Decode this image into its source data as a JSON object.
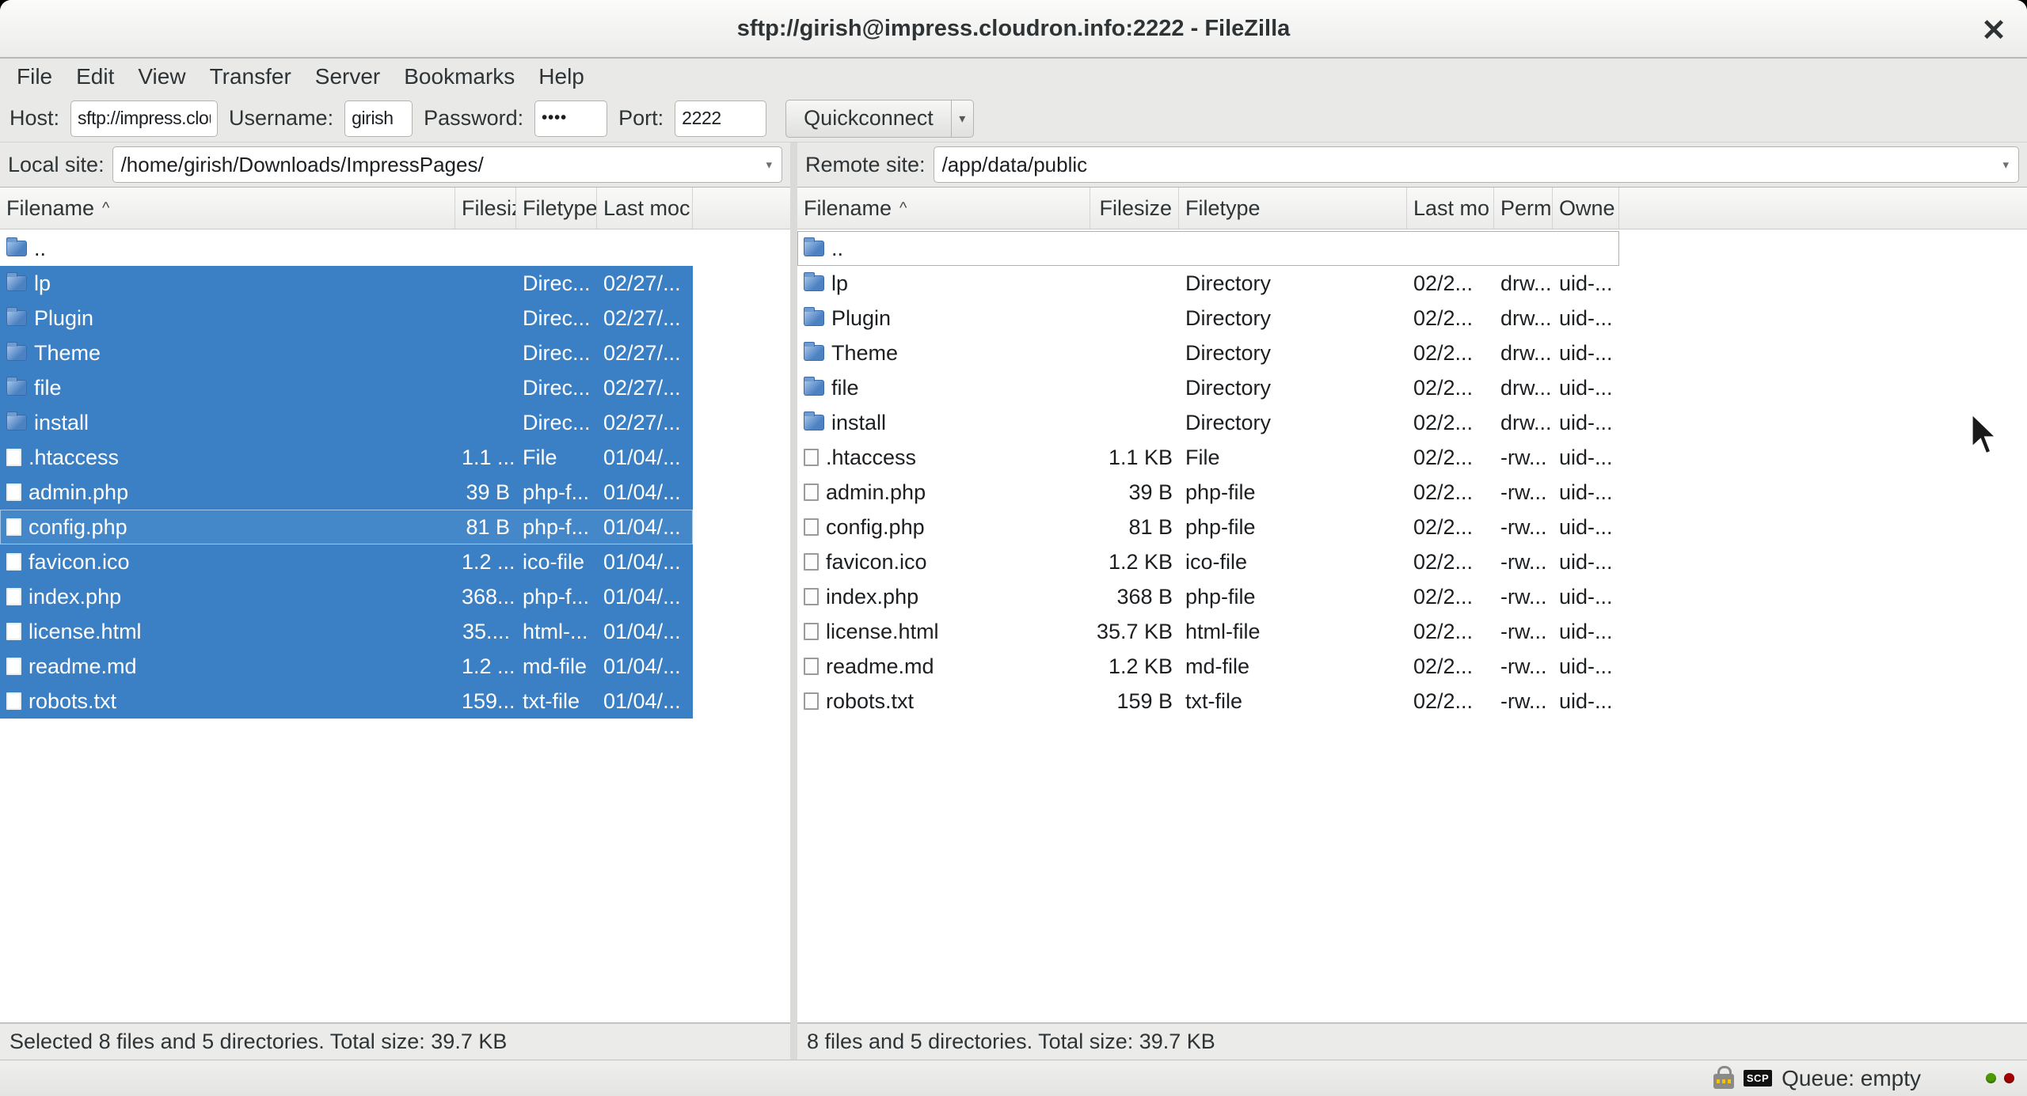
{
  "window": {
    "title": "sftp://girish@impress.cloudron.info:2222 - FileZilla",
    "close_glyph": "✕"
  },
  "menu": {
    "items": [
      "File",
      "Edit",
      "View",
      "Transfer",
      "Server",
      "Bookmarks",
      "Help"
    ]
  },
  "quickconnect": {
    "host_label": "Host:",
    "host_value": "sftp://impress.cloudr",
    "username_label": "Username:",
    "username_value": "girish",
    "password_label": "Password:",
    "password_value": "••••",
    "port_label": "Port:",
    "port_value": "2222",
    "button_label": "Quickconnect",
    "dropdown_glyph": "▾"
  },
  "local_panel": {
    "site_label": "Local site:",
    "site_value": "/home/girish/Downloads/ImpressPages/",
    "sort_indicator": "^",
    "columns": [
      "Filename",
      "Filesiz",
      "Filetype",
      "Last moc"
    ],
    "rows": [
      {
        "name": "..",
        "icon": "folder",
        "size": "",
        "filetype": "",
        "modified": "",
        "selected": false
      },
      {
        "name": "lp",
        "icon": "folder",
        "size": "",
        "filetype": "Direc...",
        "modified": "02/27/...",
        "selected": true
      },
      {
        "name": "Plugin",
        "icon": "folder",
        "size": "",
        "filetype": "Direc...",
        "modified": "02/27/...",
        "selected": true
      },
      {
        "name": "Theme",
        "icon": "folder",
        "size": "",
        "filetype": "Direc...",
        "modified": "02/27/...",
        "selected": true
      },
      {
        "name": "file",
        "icon": "folder",
        "size": "",
        "filetype": "Direc...",
        "modified": "02/27/...",
        "selected": true
      },
      {
        "name": "install",
        "icon": "folder",
        "size": "",
        "filetype": "Direc...",
        "modified": "02/27/...",
        "selected": true
      },
      {
        "name": ".htaccess",
        "icon": "file",
        "size": "1.1 ...",
        "filetype": "File",
        "modified": "01/04/...",
        "selected": true
      },
      {
        "name": "admin.php",
        "icon": "file",
        "size": "39 B",
        "filetype": "php-f...",
        "modified": "01/04/...",
        "selected": true
      },
      {
        "name": "config.php",
        "icon": "file",
        "size": "81 B",
        "filetype": "php-f...",
        "modified": "01/04/...",
        "selected": true,
        "focused": true
      },
      {
        "name": "favicon.ico",
        "icon": "file",
        "size": "1.2 ...",
        "filetype": "ico-file",
        "modified": "01/04/...",
        "selected": true
      },
      {
        "name": "index.php",
        "icon": "file",
        "size": "368...",
        "filetype": "php-f...",
        "modified": "01/04/...",
        "selected": true
      },
      {
        "name": "license.html",
        "icon": "file",
        "size": "35....",
        "filetype": "html-...",
        "modified": "01/04/...",
        "selected": true
      },
      {
        "name": "readme.md",
        "icon": "file",
        "size": "1.2 ...",
        "filetype": "md-file",
        "modified": "01/04/...",
        "selected": true
      },
      {
        "name": "robots.txt",
        "icon": "file",
        "size": "159...",
        "filetype": "txt-file",
        "modified": "01/04/...",
        "selected": true
      }
    ],
    "status": "Selected 8 files and 5 directories. Total size: 39.7 KB"
  },
  "remote_panel": {
    "site_label": "Remote site:",
    "site_value": "/app/data/public",
    "sort_indicator": "^",
    "columns": [
      "Filename",
      "Filesize",
      "Filetype",
      "Last mo",
      "Permi",
      "Owne"
    ],
    "rows": [
      {
        "name": "..",
        "icon": "folder",
        "size": "",
        "filetype": "",
        "modified": "",
        "perms": "",
        "owner": "",
        "focused": true
      },
      {
        "name": "lp",
        "icon": "folder",
        "size": "",
        "filetype": "Directory",
        "modified": "02/2...",
        "perms": "drw...",
        "owner": "uid-..."
      },
      {
        "name": "Plugin",
        "icon": "folder",
        "size": "",
        "filetype": "Directory",
        "modified": "02/2...",
        "perms": "drw...",
        "owner": "uid-..."
      },
      {
        "name": "Theme",
        "icon": "folder",
        "size": "",
        "filetype": "Directory",
        "modified": "02/2...",
        "perms": "drw...",
        "owner": "uid-..."
      },
      {
        "name": "file",
        "icon": "folder",
        "size": "",
        "filetype": "Directory",
        "modified": "02/2...",
        "perms": "drw...",
        "owner": "uid-..."
      },
      {
        "name": "install",
        "icon": "folder",
        "size": "",
        "filetype": "Directory",
        "modified": "02/2...",
        "perms": "drw...",
        "owner": "uid-..."
      },
      {
        "name": ".htaccess",
        "icon": "file",
        "size": "1.1 KB",
        "filetype": "File",
        "modified": "02/2...",
        "perms": "-rw...",
        "owner": "uid-..."
      },
      {
        "name": "admin.php",
        "icon": "file",
        "size": "39 B",
        "filetype": "php-file",
        "modified": "02/2...",
        "perms": "-rw...",
        "owner": "uid-..."
      },
      {
        "name": "config.php",
        "icon": "file",
        "size": "81 B",
        "filetype": "php-file",
        "modified": "02/2...",
        "perms": "-rw...",
        "owner": "uid-..."
      },
      {
        "name": "favicon.ico",
        "icon": "file",
        "size": "1.2 KB",
        "filetype": "ico-file",
        "modified": "02/2...",
        "perms": "-rw...",
        "owner": "uid-..."
      },
      {
        "name": "index.php",
        "icon": "file",
        "size": "368 B",
        "filetype": "php-file",
        "modified": "02/2...",
        "perms": "-rw...",
        "owner": "uid-..."
      },
      {
        "name": "license.html",
        "icon": "file",
        "size": "35.7 KB",
        "filetype": "html-file",
        "modified": "02/2...",
        "perms": "-rw...",
        "owner": "uid-..."
      },
      {
        "name": "readme.md",
        "icon": "file",
        "size": "1.2 KB",
        "filetype": "md-file",
        "modified": "02/2...",
        "perms": "-rw...",
        "owner": "uid-..."
      },
      {
        "name": "robots.txt",
        "icon": "file",
        "size": "159 B",
        "filetype": "txt-file",
        "modified": "02/2...",
        "perms": "-rw...",
        "owner": "uid-..."
      }
    ],
    "status": "8 files and 5 directories. Total size: 39.7 KB"
  },
  "statusbar": {
    "protocol_badge": "SCP",
    "queue_label": "Queue: empty"
  },
  "colors": {
    "selection_blue": "#3b7fc4",
    "folder_blue": "#4d82c2",
    "led_green": "#4e9a06",
    "led_red": "#a40000",
    "chrome_gray": "#e9e9e8"
  }
}
